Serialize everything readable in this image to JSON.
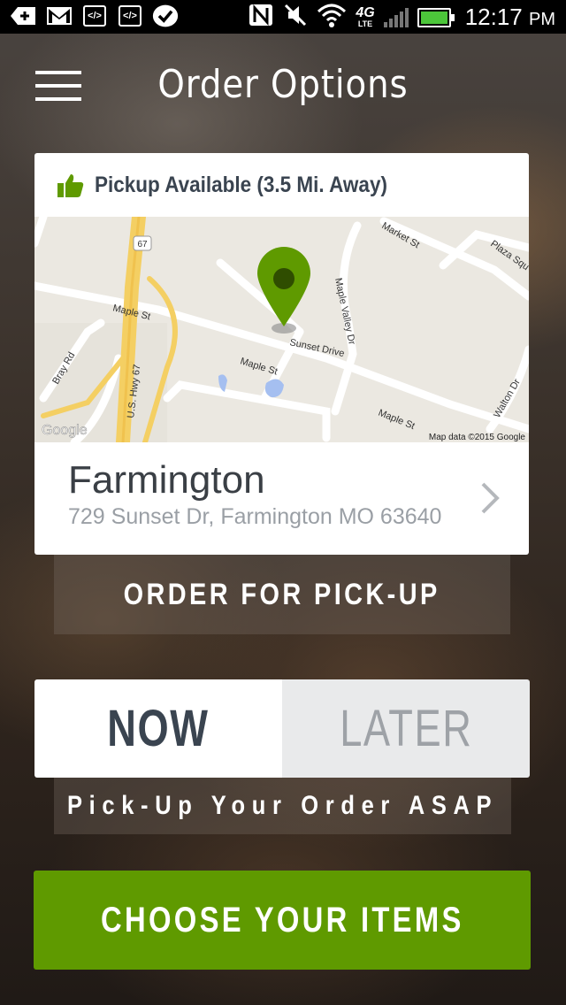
{
  "status_bar": {
    "time": "12:17",
    "ampm": "PM",
    "network": "4G",
    "network_sub": "LTE",
    "battery_color": "#4cc63a"
  },
  "header": {
    "title": "Order Options",
    "menu_icon": "hamburger-menu-icon"
  },
  "pickup": {
    "availability": "Pickup Available (3.5 Mi. Away)",
    "icon": "thumbs-up-icon",
    "icon_color": "#5f9a00"
  },
  "map": {
    "labels": {
      "hwy": "67",
      "us_hwy": "U.S. Hwy 67",
      "maple_st_1": "Maple St",
      "maple_st_2": "Maple St",
      "maple_st_3": "Maple St",
      "sunset": "Sunset Drive",
      "maple_valley": "Maple Valley Dr",
      "market": "Market St",
      "plaza": "Plaza Squ",
      "bray": "Bray Rd",
      "walton": "Walton Dr",
      "google": "Google",
      "attribution": "Map data ©2015 Google"
    },
    "pin_color": "#5f9a00"
  },
  "location": {
    "name": "Farmington",
    "address": "729 Sunset Dr, Farmington MO 63640"
  },
  "order_pickup_label": "ORDER FOR PICK-UP",
  "timing": {
    "now_label": "NOW",
    "later_label": "LATER",
    "selected": "NOW",
    "description": "Pick-Up Your Order ASAP"
  },
  "cta": {
    "label": "CHOOSE YOUR ITEMS",
    "color": "#5f9a00"
  }
}
